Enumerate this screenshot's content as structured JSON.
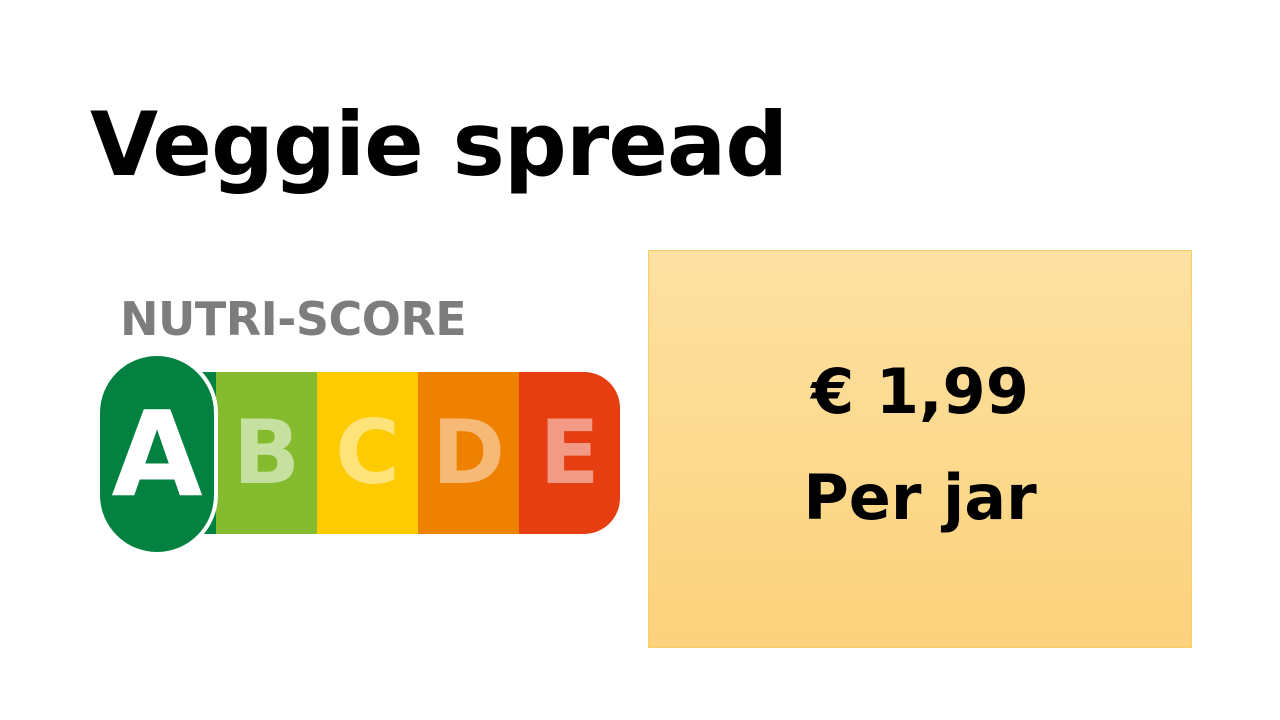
{
  "product": {
    "title": "Veggie spread"
  },
  "nutri_score": {
    "header": "NUTRI-SCORE",
    "selected": "A",
    "grades": [
      {
        "letter": "A",
        "color": "#038141",
        "letter_color": "#ffffff"
      },
      {
        "letter": "B",
        "color": "#85bb2f",
        "letter_color": "#c6e0a0"
      },
      {
        "letter": "C",
        "color": "#fecb02",
        "letter_color": "#fee27a"
      },
      {
        "letter": "D",
        "color": "#ee8100",
        "letter_color": "#f6b976"
      },
      {
        "letter": "E",
        "color": "#e63e11",
        "letter_color": "#f29a85"
      }
    ]
  },
  "price": {
    "amount": "€ 1,99",
    "unit": "Per jar"
  },
  "colors": {
    "price_box_fill": "#fcd98d",
    "price_box_border": "#f5cf6a",
    "header_gray": "#7d7d7d"
  }
}
